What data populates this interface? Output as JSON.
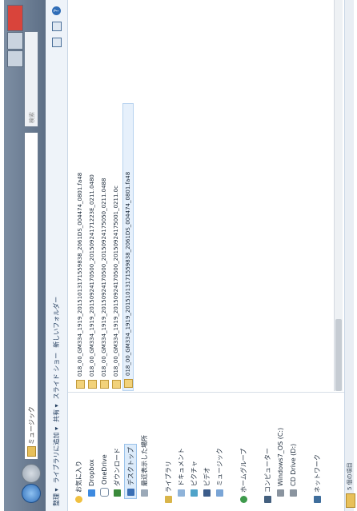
{
  "address": {
    "path": "ミュージック"
  },
  "search": {
    "placeholder": "検索"
  },
  "toolbar": {
    "organize": "整理 ▾",
    "include_library": "ライブラリに追加 ▾",
    "share": "共有 ▾",
    "slideshow": "スライド ショー",
    "new_folder": "新しいフォルダー",
    "help": "?"
  },
  "nav": {
    "favorites": "お気に入り",
    "dropbox": "Dropbox",
    "onedrive": "OneDrive",
    "downloads": "ダウンロード",
    "desktop": "デスクトップ",
    "recent": "最近表示した場所",
    "libraries": "ライブラリ",
    "documents": "ドキュメント",
    "pictures": "ピクチャ",
    "videos": "ビデオ",
    "music": "ミュージック",
    "homegroup": "ホームグループ",
    "computer": "コンピューター",
    "windows_drive": "Windows7_OS (C:)",
    "cd_drive": "CD Drive (D:)",
    "network": "ネットワーク"
  },
  "files": [
    "018_00_GM334_1919_20151013171559838_2061DS_004474_0801.fa48",
    "018_00_GM334_1919_20150924170500_20150924171223E_0211.0480",
    "018_00_GM334_1919_20150924170500_20150924175050_0211.0488",
    "018_00_GM334_1919_20150924170500_20150924175001_0211.0c",
    "018_00_GM334_1919_20151013171559838_2061DS_004474_0801.fa48"
  ],
  "details": {
    "text": "5 個の項目"
  }
}
